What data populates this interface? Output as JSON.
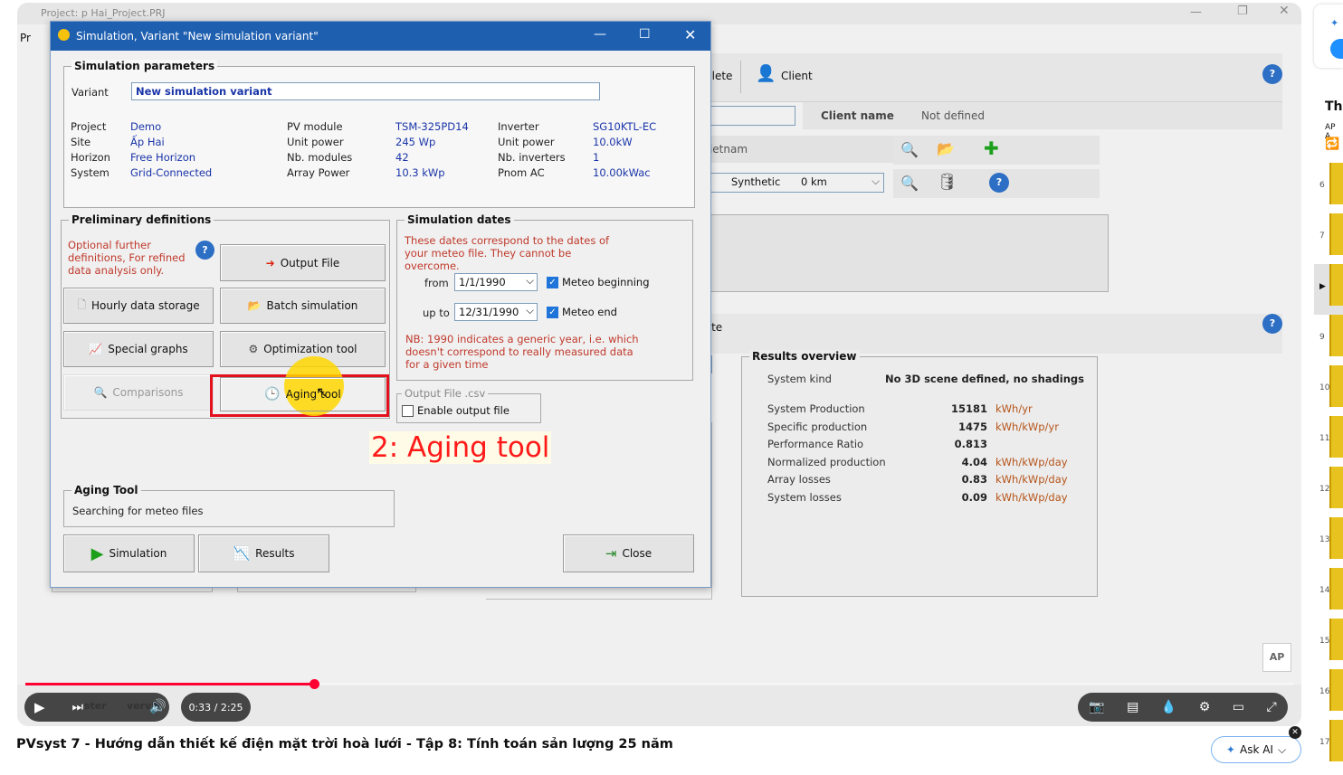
{
  "video": {
    "title": "PVsyst 7 - Hướng dẫn thiết kế điện mặt trời hoà lưới - Tập 8: Tính toán sản lượng 25 năm",
    "time": "0:33 / 2:25",
    "progress": 0.228,
    "chapter_partial": "ster",
    "chapter_partial2": "vervi",
    "ask_ai": "Ask AI"
  },
  "background_app": {
    "window_title": "Project: p Hai_Project.PRJ",
    "left_stub": "Pr",
    "toolbar": {
      "delete": "Delete",
      "client": "Client"
    },
    "client_name_label": "Client name",
    "client_name_value": "Not defined",
    "site_value": "Vietnam",
    "meteo_pct": "%",
    "meteo_kind": "Synthetic",
    "meteo_dist": "0 km",
    "delete2": "elete",
    "results_overview": {
      "title": "Results overview",
      "system_kind_label": "System kind",
      "system_kind_value": "No 3D scene defined, no shadings",
      "rows": [
        {
          "label": "System Production",
          "value": "15181",
          "unit": "kWh/yr"
        },
        {
          "label": "Specific production",
          "value": "1475",
          "unit": "kWh/kWp/yr"
        },
        {
          "label": "Performance Ratio",
          "value": "0.813",
          "unit": ""
        },
        {
          "label": "Normalized production",
          "value": "4.04",
          "unit": "kWh/kWp/day"
        },
        {
          "label": "Array losses",
          "value": "0.83",
          "unit": "kWh/kWp/day"
        },
        {
          "label": "System losses",
          "value": "0.09",
          "unit": "kWh/kWp/day"
        }
      ]
    }
  },
  "dialog": {
    "title": "Simulation, Variant \"New simulation variant\"",
    "sim_params": {
      "label": "Simulation parameters",
      "variant_label": "Variant",
      "variant_value": "New simulation variant",
      "col1": [
        {
          "label": "Project",
          "value": "Demo"
        },
        {
          "label": "Site",
          "value": "Ấp Hai"
        },
        {
          "label": "Horizon",
          "value": "Free Horizon"
        },
        {
          "label": "System",
          "value": "Grid-Connected"
        }
      ],
      "col2": [
        {
          "label": "PV module",
          "value": "TSM-325PD14"
        },
        {
          "label": "Unit power",
          "value": "245  Wp"
        },
        {
          "label": "Nb. modules",
          "value": "42"
        },
        {
          "label": "Array Power",
          "value": "10.3  kWp"
        }
      ],
      "col3": [
        {
          "label": "Inverter",
          "value": "SG10KTL-EC"
        },
        {
          "label": "Unit power",
          "value": "10.0kW"
        },
        {
          "label": "Nb. inverters",
          "value": "1"
        },
        {
          "label": "Pnom AC",
          "value": "10.00kWac"
        }
      ]
    },
    "prelim": {
      "label": "Preliminary definitions",
      "note": "Optional further definitions, For refined data analysis only.",
      "buttons": {
        "output_file": "Output File",
        "hourly": "Hourly data storage",
        "batch": "Batch simulation",
        "special": "Special graphs",
        "optim": "Optimization tool",
        "compare": "Comparisons",
        "aging": "Aging tool"
      }
    },
    "sim_dates": {
      "label": "Simulation dates",
      "note": "These dates correspond to the dates of your meteo file. They cannot be overcome.",
      "from_label": "from",
      "from_value": "1/1/1990",
      "upto_label": "up to",
      "upto_value": "12/31/1990",
      "meteo_begin": "Meteo beginning",
      "meteo_end": "Meteo end",
      "nb": "NB: 1990 indicates a generic year, i.e. which doesn't correspond to really measured data for a given time"
    },
    "output_csv": {
      "label": "Output File .csv",
      "enable": "Enable output file"
    },
    "annotation": "2: Aging tool",
    "aging": {
      "label": "Aging Tool",
      "status": "Searching for meteo files"
    },
    "bottom": {
      "simulation": "Simulation",
      "results": "Results",
      "close": "Close"
    }
  },
  "sidebar": {
    "numbers": [
      "6",
      "7",
      "",
      "9",
      "10",
      "11",
      "12",
      "13",
      "14",
      "15",
      "16",
      "17"
    ],
    "partial_title": "Th",
    "partial_sub": "AP A"
  },
  "colors": {
    "titlebar": "#1e5fb0",
    "progress": "#ff0033",
    "annotation": "#ff1a1a",
    "highlight": "#ffd500"
  }
}
